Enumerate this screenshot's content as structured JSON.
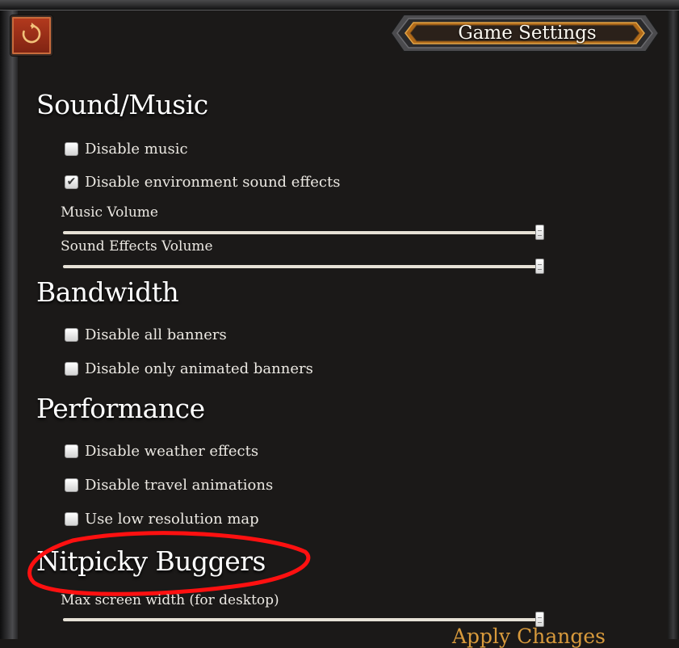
{
  "header": {
    "title": "Game Settings",
    "refresh_icon": "refresh-icon"
  },
  "sections": [
    {
      "title": "Sound/Music",
      "options": [
        {
          "label": "Disable music",
          "checked": false
        },
        {
          "label": "Disable environment sound effects",
          "checked": true
        }
      ],
      "sliders": [
        {
          "label": "Music Volume",
          "value_fraction": 1.0
        },
        {
          "label": "Sound Effects Volume",
          "value_fraction": 1.0
        }
      ]
    },
    {
      "title": "Bandwidth",
      "options": [
        {
          "label": "Disable all banners",
          "checked": false
        },
        {
          "label": "Disable only animated banners",
          "checked": false
        }
      ]
    },
    {
      "title": "Performance",
      "options": [
        {
          "label": "Disable weather effects",
          "checked": false
        },
        {
          "label": "Disable travel animations",
          "checked": false
        },
        {
          "label": "Use low resolution map",
          "checked": false
        }
      ]
    },
    {
      "title": "Nitpicky Buggers",
      "sliders": [
        {
          "label": "Max screen width (for desktop)",
          "value_fraction": 1.0
        }
      ]
    }
  ],
  "footer": {
    "apply_label": "Apply Changes"
  },
  "colors": {
    "background": "#1b1918",
    "accent_gold": "#d89a3c",
    "refresh_red": "#9c2c17",
    "annotation_red": "#ff1010"
  }
}
